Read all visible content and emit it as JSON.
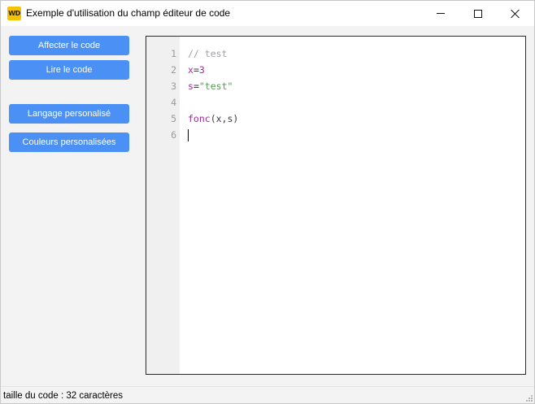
{
  "window": {
    "title": "Exemple d'utilisation du champ éditeur de code",
    "app_icon_text": "WD"
  },
  "buttons": {
    "affecter": "Affecter le code",
    "lire": "Lire le code",
    "langage": "Langage personalisé",
    "couleurs": "Couleurs personalisées"
  },
  "editor": {
    "lines": [
      {
        "number": "1",
        "tokens": [
          {
            "type": "comment",
            "text": "// test"
          }
        ]
      },
      {
        "number": "2",
        "tokens": [
          {
            "type": "var",
            "text": "x"
          },
          {
            "type": "op",
            "text": "="
          },
          {
            "type": "num",
            "text": "3"
          }
        ]
      },
      {
        "number": "3",
        "tokens": [
          {
            "type": "var",
            "text": "s"
          },
          {
            "type": "op",
            "text": "="
          },
          {
            "type": "str",
            "text": "\"test\""
          }
        ]
      },
      {
        "number": "4",
        "tokens": []
      },
      {
        "number": "5",
        "tokens": [
          {
            "type": "fn",
            "text": "fonc"
          },
          {
            "type": "op",
            "text": "(x,s)"
          }
        ]
      },
      {
        "number": "6",
        "tokens": []
      }
    ],
    "caret_line": 6
  },
  "status": {
    "text": "taille du code : 32 caractères"
  },
  "colors": {
    "button_bg": "#4a90f5",
    "comment": "#a0a1a7",
    "keyword": "#a626a4",
    "string": "#50a14f"
  }
}
